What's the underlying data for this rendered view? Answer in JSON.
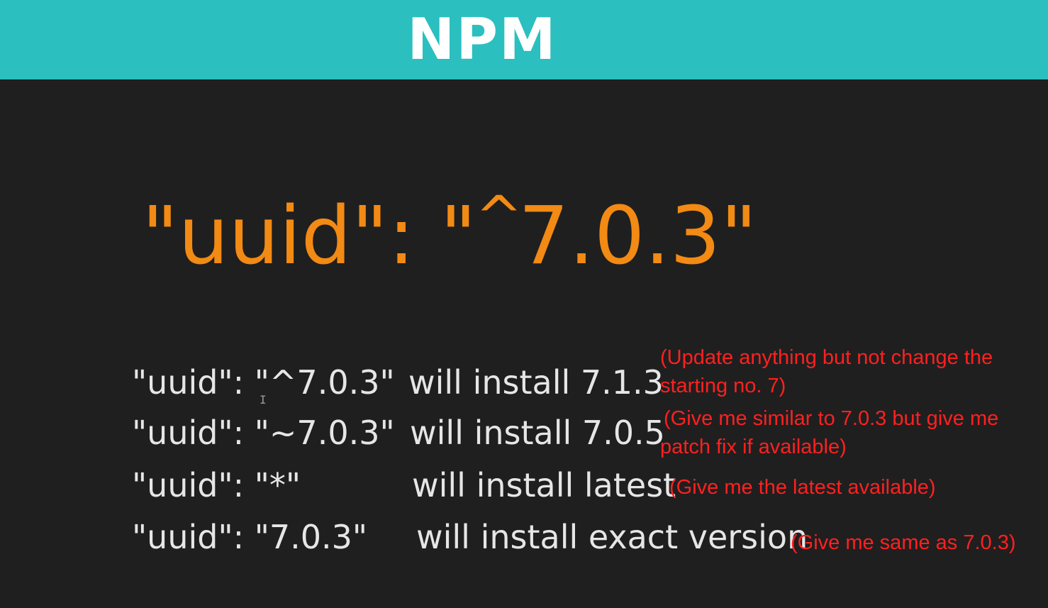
{
  "header": {
    "title": "NPM"
  },
  "main": {
    "headline_prefix": "\"uuid\": \"",
    "headline_caret": "^",
    "headline_suffix": "7.0.3\""
  },
  "rows": [
    {
      "spec": "\"uuid\": \"^7.0.3\"",
      "result": "will install 7.1.3",
      "note_line1": "(Update anything but not change the",
      "note_line2": "starting no. 7)"
    },
    {
      "spec": "\"uuid\": \"~7.0.3\"",
      "result": "will install  7.0.5",
      "note_line1": "(Give me similar to 7.0.3 but give me",
      "note_line2": "patch fix if available)"
    },
    {
      "spec": "\"uuid\": \"*\"",
      "result": "will install latest",
      "note_line1": "(Give me the latest available)"
    },
    {
      "spec": "\"uuid\": \"7.0.3\"",
      "result": "will install exact version",
      "note_line1": "(Give me same as 7.0.3)"
    }
  ],
  "colors": {
    "header_bg": "#2bbfbf",
    "slide_bg": "#1f1f1f",
    "headline": "#f28a14",
    "body_text": "#e6e6e6",
    "annotation": "#ff2020"
  },
  "icons": {
    "cursor": "text-cursor-icon"
  }
}
